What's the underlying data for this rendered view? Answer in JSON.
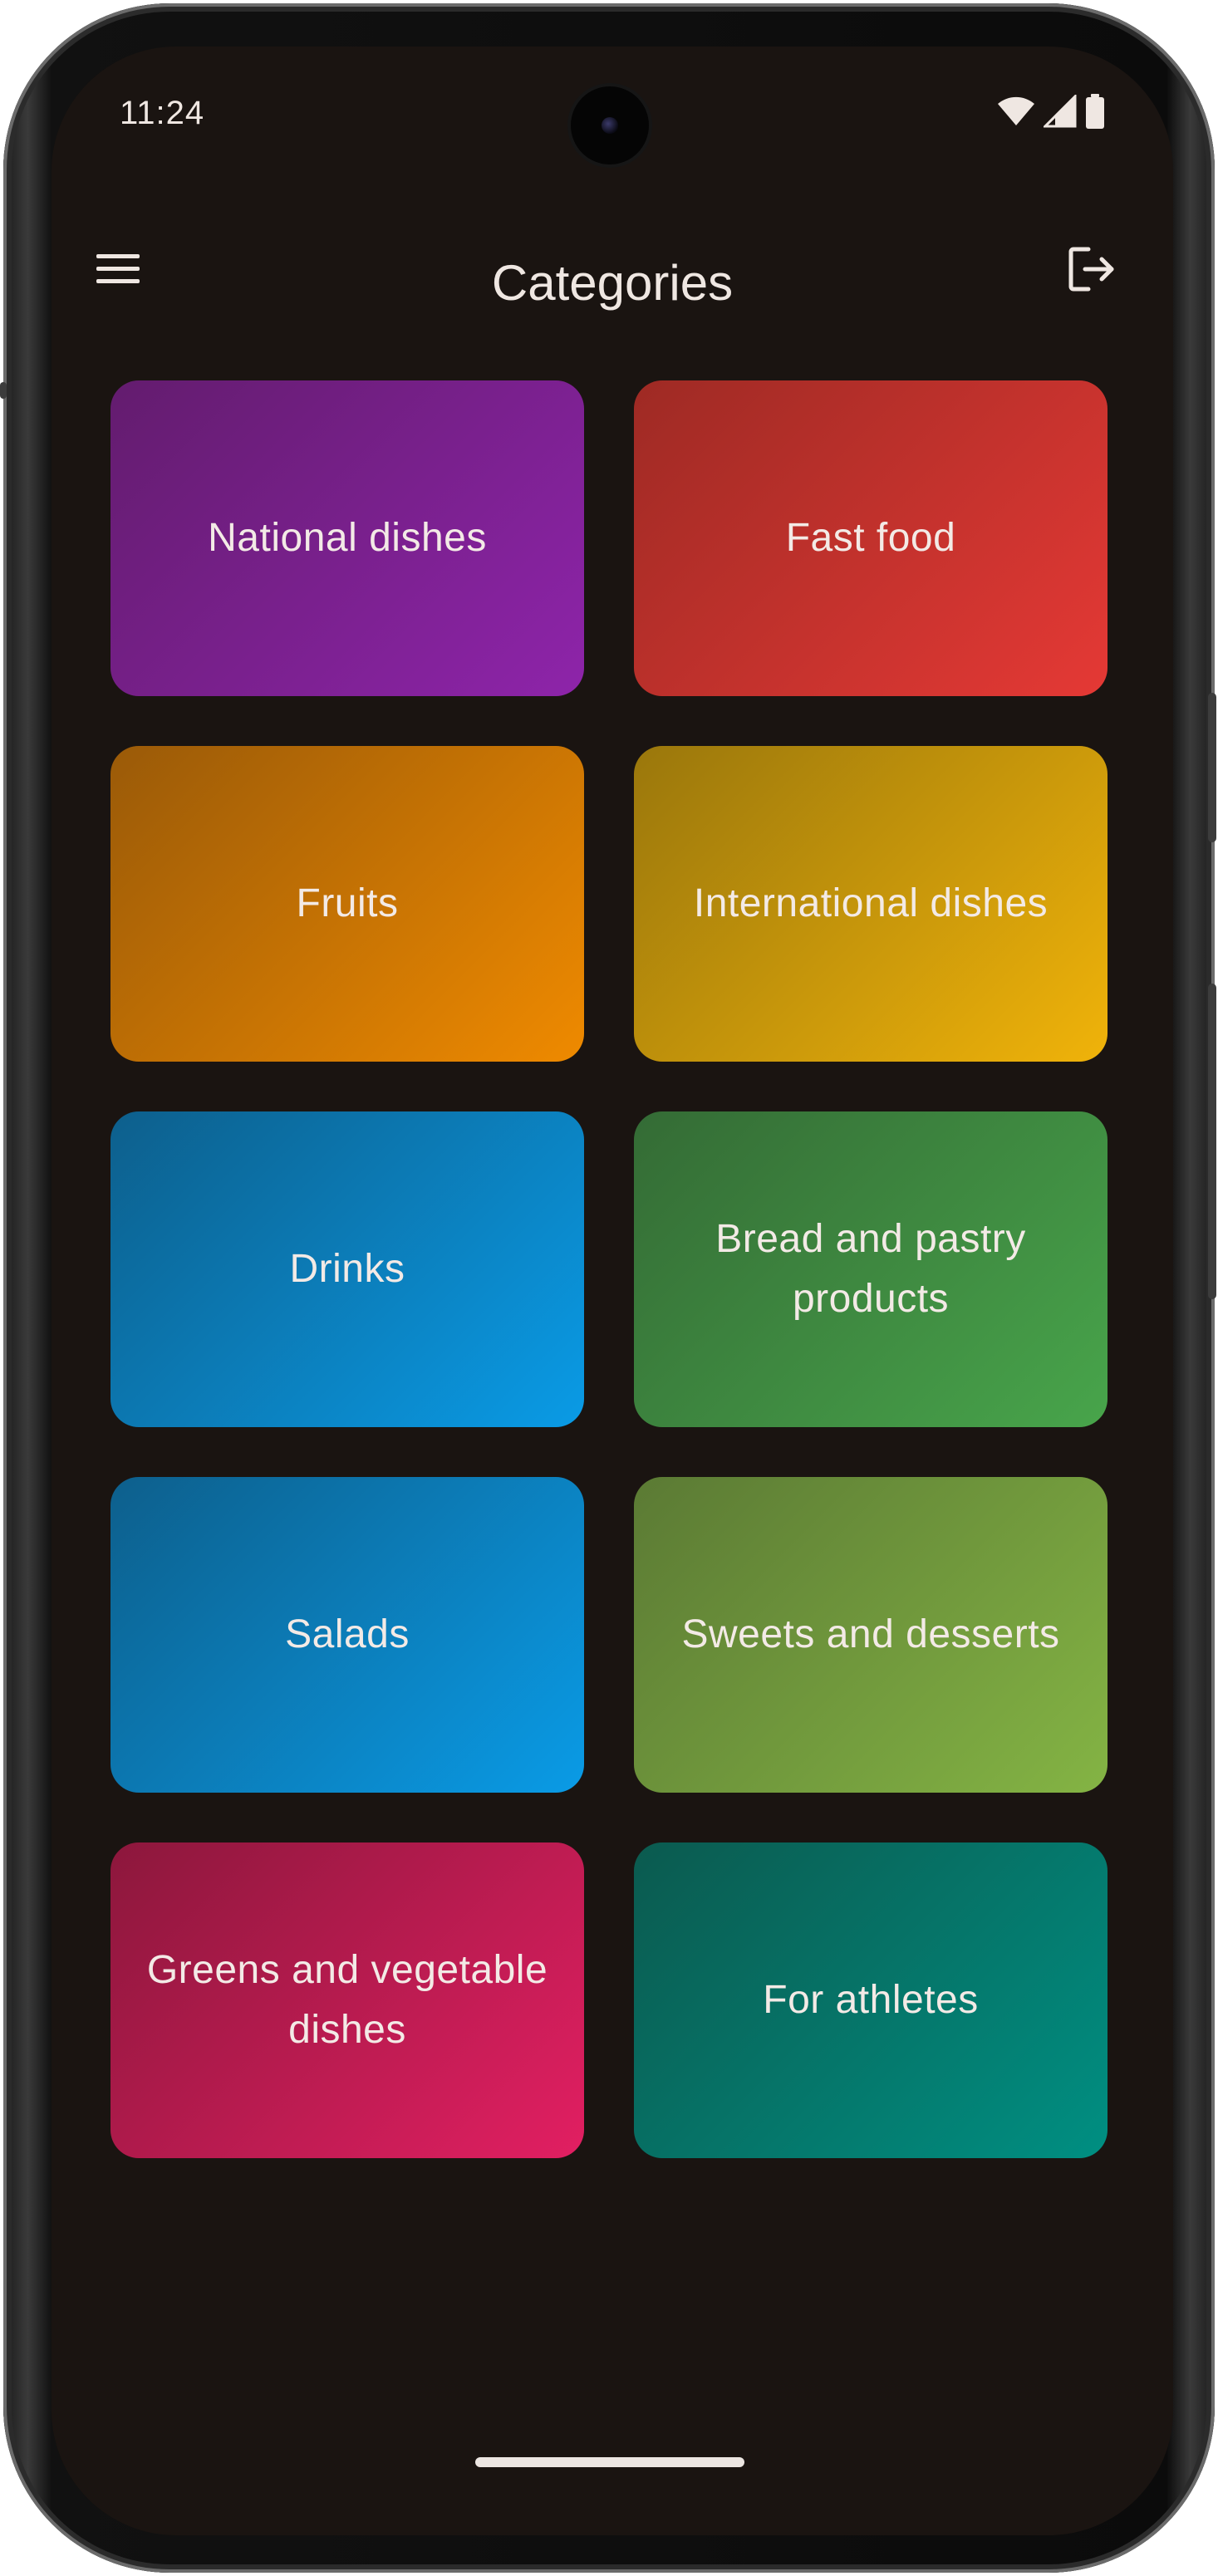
{
  "status_bar": {
    "time": "11:24",
    "icons": [
      "wifi-icon",
      "signal-icon",
      "battery-icon"
    ]
  },
  "app_bar": {
    "title": "Categories",
    "menu_icon": "menu-icon",
    "logout_icon": "logout-icon"
  },
  "colors": {
    "background": "#1a1411",
    "text": "#efe7e2"
  },
  "categories": [
    {
      "label": "National dishes",
      "color_start": "#631c6e",
      "color_end": "#8e24aa"
    },
    {
      "label": "Fast food",
      "color_start": "#9e2a24",
      "color_end": "#e53935"
    },
    {
      "label": "Fruits",
      "color_start": "#9a5a08",
      "color_end": "#ef8a00"
    },
    {
      "label": "International dishes",
      "color_start": "#9a770c",
      "color_end": "#f0b30a"
    },
    {
      "label": "Drinks",
      "color_start": "#0d5f8c",
      "color_end": "#0a9be6"
    },
    {
      "label": "Bread and pastry products",
      "color_start": "#346b35",
      "color_end": "#48a54b"
    },
    {
      "label": "Salads",
      "color_start": "#0d5f8c",
      "color_end": "#0a9be6"
    },
    {
      "label": "Sweets and desserts",
      "color_start": "#5b7a34",
      "color_end": "#84b444"
    },
    {
      "label": "Greens and vegetable dishes",
      "color_start": "#8c173c",
      "color_end": "#e21f62"
    },
    {
      "label": "For athletes",
      "color_start": "#0b5a4f",
      "color_end": "#008f82"
    }
  ]
}
